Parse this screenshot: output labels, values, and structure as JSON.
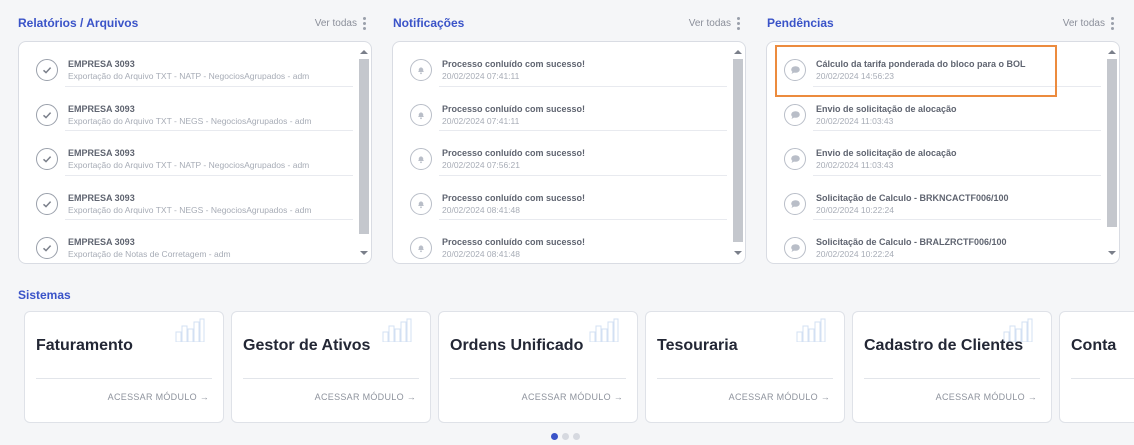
{
  "panels": {
    "reports": {
      "title": "Relatórios / Arquivos",
      "see_all": "Ver todas",
      "items": [
        {
          "title": "EMPRESA 3093",
          "subtitle": "Exportação do Arquivo TXT - NATP - NegociosAgrupados - adm"
        },
        {
          "title": "EMPRESA 3093",
          "subtitle": "Exportação do Arquivo TXT - NEGS - NegociosAgrupados - adm"
        },
        {
          "title": "EMPRESA 3093",
          "subtitle": "Exportação do Arquivo TXT - NATP - NegociosAgrupados - adm"
        },
        {
          "title": "EMPRESA 3093",
          "subtitle": "Exportação do Arquivo TXT - NEGS - NegociosAgrupados - adm"
        },
        {
          "title": "EMPRESA 3093",
          "subtitle": "Exportação de Notas de Corretagem - adm"
        }
      ]
    },
    "notifications": {
      "title": "Notificações",
      "see_all": "Ver todas",
      "items": [
        {
          "title": "Processo conluído com sucesso!",
          "subtitle": "20/02/2024 07:41:11"
        },
        {
          "title": "Processo conluído com sucesso!",
          "subtitle": "20/02/2024 07:41:11"
        },
        {
          "title": "Processo conluído com sucesso!",
          "subtitle": "20/02/2024 07:56:21"
        },
        {
          "title": "Processo conluído com sucesso!",
          "subtitle": "20/02/2024 08:41:48"
        },
        {
          "title": "Processo conluído com sucesso!",
          "subtitle": "20/02/2024 08:41:48"
        }
      ]
    },
    "pending": {
      "title": "Pendências",
      "see_all": "Ver todas",
      "items": [
        {
          "title": "Cálculo da tarifa ponderada do bloco para o BOL",
          "subtitle": "20/02/2024 14:56:23"
        },
        {
          "title": "Envio de solicitação de alocação",
          "subtitle": "20/02/2024 11:03:43"
        },
        {
          "title": "Envio de solicitação de alocação",
          "subtitle": "20/02/2024 11:03:43"
        },
        {
          "title": "Solicitação de Calculo - BRKNCACTF006/100",
          "subtitle": "20/02/2024 10:22:24"
        },
        {
          "title": "Solicitação de Calculo - BRALZRCTF006/100",
          "subtitle": "20/02/2024 10:22:24"
        }
      ]
    }
  },
  "systems": {
    "title": "Sistemas",
    "modules": [
      {
        "name": "Faturamento",
        "link": "ACESSAR MÓDULO →"
      },
      {
        "name": "Gestor de Ativos",
        "link": "ACESSAR MÓDULO →"
      },
      {
        "name": "Ordens Unificado",
        "link": "ACESSAR MÓDULO →"
      },
      {
        "name": "Tesouraria",
        "link": "ACESSAR MÓDULO →"
      },
      {
        "name": "Cadastro de Clientes",
        "link": "ACESSAR MÓDULO →"
      },
      {
        "name": "Conta",
        "link": ""
      }
    ]
  },
  "carousel": {
    "pages": 3,
    "active": 0
  },
  "colors": {
    "accent": "#3a53c8",
    "highlight": "#ec8b3e"
  }
}
